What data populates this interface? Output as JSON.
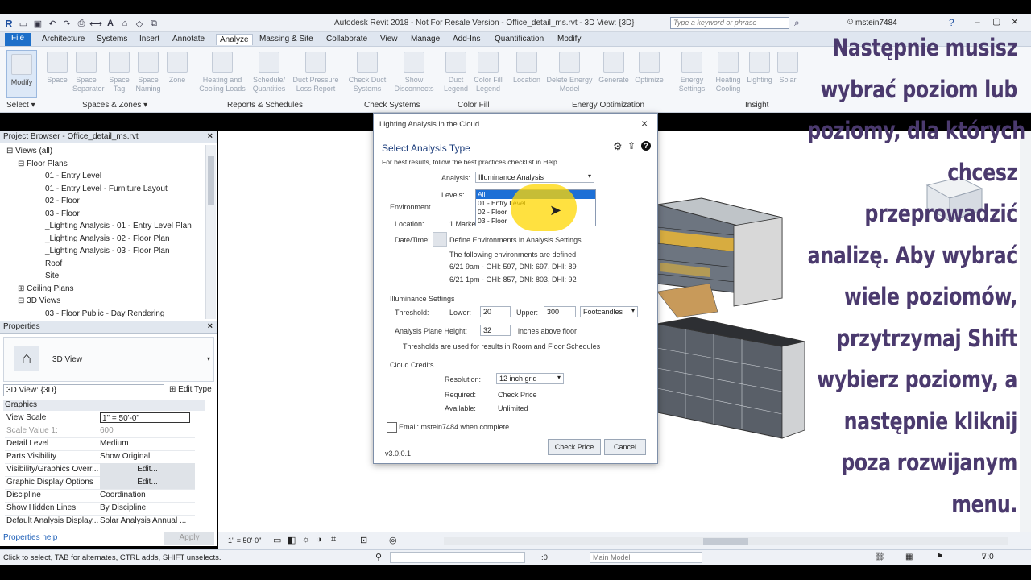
{
  "app": {
    "title": "Autodesk Revit 2018 - Not For Resale Version -    Office_detail_ms.rvt - 3D View: {3D}",
    "search_placeholder": "Type a keyword or phrase",
    "user": "mstein7484"
  },
  "tabs": [
    "File",
    "Architecture",
    "Systems",
    "Insert",
    "Annotate",
    "Analyze",
    "Massing & Site",
    "Collaborate",
    "View",
    "Manage",
    "Add-Ins",
    "Quantification",
    "Modify"
  ],
  "active_tab": "Analyze",
  "ribbon": {
    "modify": "Modify",
    "buttons": [
      "Space",
      "Space Separator",
      "Space Tag",
      "Space Naming",
      "Zone",
      "Heating and Cooling Loads",
      "Schedule/ Quantities",
      "Duct Pressure Loss Report",
      "Check Duct Systems",
      "Show Disconnects",
      "Duct Legend",
      "Color Fill Legend",
      "Location",
      "Delete Energy Model",
      "Generate",
      "Optimize",
      "Energy Settings",
      "Heating Cooling",
      "Lighting",
      "Solar"
    ],
    "panels": [
      "Select ▾",
      "Spaces & Zones ▾",
      "Reports & Schedules",
      "Check Systems",
      "Color Fill",
      "Energy Optimization",
      "Insight"
    ]
  },
  "project_browser": {
    "title": "Project Browser - Office_detail_ms.rvt",
    "items": [
      "Views (all)",
      "Floor Plans",
      "01 - Entry Level",
      "01 - Entry Level - Furniture Layout",
      "02 - Floor",
      "03 - Floor",
      "_Lighting Analysis - 01 - Entry Level Plan",
      "_Lighting Analysis - 02 - Floor Plan",
      "_Lighting Analysis - 03 - Floor Plan",
      "Roof",
      "Site",
      "Ceiling Plans",
      "3D Views",
      "03 - Floor Public - Day Rendering"
    ]
  },
  "properties": {
    "title": "Properties",
    "type": "3D View",
    "selector": "3D View: {3D}",
    "edit_type": "Edit Type",
    "section": "Graphics",
    "rows": [
      {
        "k": "View Scale",
        "v": "1\" = 50'-0\""
      },
      {
        "k": "Scale Value    1:",
        "v": "600"
      },
      {
        "k": "Detail Level",
        "v": "Medium"
      },
      {
        "k": "Parts Visibility",
        "v": "Show Original"
      },
      {
        "k": "Visibility/Graphics Overr...",
        "v": "Edit..."
      },
      {
        "k": "Graphic Display Options",
        "v": "Edit..."
      },
      {
        "k": "Discipline",
        "v": "Coordination"
      },
      {
        "k": "Show Hidden Lines",
        "v": "By Discipline"
      },
      {
        "k": "Default Analysis Display...",
        "v": "Solar Analysis Annual ..."
      }
    ],
    "help": "Properties help",
    "apply": "Apply"
  },
  "dialog": {
    "title": "Lighting Analysis in the Cloud",
    "heading": "Select Analysis Type",
    "hint": "For best results, follow the best practices checklist in Help",
    "analysis_label": "Analysis:",
    "analysis_value": "Illuminance Analysis",
    "levels_label": "Levels:",
    "levels": [
      "All",
      "01 - Entry Level",
      "02 - Floor",
      "03 - Floor"
    ],
    "environment_label": "Environment",
    "location_label": "Location:",
    "location_value": "1 Marke",
    "datetime_label": "Date/Time:",
    "define_env": "Define Environments in Analysis Settings",
    "env_intro": "The following environments are defined",
    "env1": "6/21 9am - GHI: 597, DNI: 697, DHI: 89",
    "env2": "6/21 1pm - GHI: 857, DNI: 803, DHI: 92",
    "illum_label": "Illuminance Settings",
    "threshold_label": "Threshold:",
    "lower_label": "Lower:",
    "lower_value": "20",
    "upper_label": "Upper:",
    "upper_value": "300",
    "unit_value": "Footcandles",
    "plane_label": "Analysis Plane Height:",
    "plane_value": "32",
    "plane_unit": "inches above floor",
    "threshold_note": "Thresholds are used for results in Room and Floor Schedules",
    "credits_label": "Cloud Credits",
    "resolution_label": "Resolution:",
    "resolution_value": "12 inch grid",
    "required_label": "Required:",
    "required_value": "Check Price",
    "available_label": "Available:",
    "available_value": "Unlimited",
    "email_label": "Email: mstein7484 when complete",
    "version": "v3.0.0.1",
    "check_price": "Check Price",
    "cancel": "Cancel"
  },
  "viewbar": {
    "scale": "1\" = 50'-0\""
  },
  "status": {
    "hint": "Click to select, TAB for alternates, CTRL adds, SHIFT unselects.",
    "count": ":0",
    "model": "Main Model"
  },
  "caption": [
    "Następnie musisz",
    "wybrać poziom lub",
    "poziomy, dla których",
    "chcesz",
    "przeprowadzić",
    "analizę. Aby wybrać",
    "wiele poziomów,",
    "przytrzymaj Shift",
    "wybierz poziomy, a",
    "następnie kliknij",
    "poza rozwijanym",
    "menu."
  ]
}
